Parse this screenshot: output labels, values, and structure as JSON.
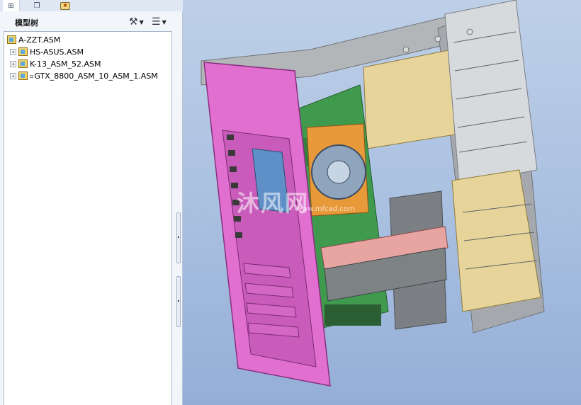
{
  "tabs": [
    {
      "icon": "model-tree-icon"
    },
    {
      "icon": "folder-browser-icon"
    },
    {
      "icon": "favorites-icon"
    }
  ],
  "model_tree": {
    "title": "模型树",
    "settings_icon": "settings-icon",
    "show_icon": "show-icon",
    "root": "A-ZZT.ASM",
    "items": [
      {
        "label": "HS-ASUS.ASM"
      },
      {
        "label": "K-13_ASM_52.ASM"
      },
      {
        "label": "GTX_8800_ASM_10_ASM_1.ASM"
      }
    ]
  },
  "viewport": {
    "watermark": "沐风网",
    "watermark_sub": "www.mfcad.com"
  },
  "colors": {
    "viewport_top": "#bed0e8",
    "viewport_bottom": "#94aed6",
    "case_frame_pink": "#e06fcf",
    "case_body_gray": "#a5a9ad",
    "drive_bay_tan": "#e7d49a",
    "motherboard_green": "#3f9a4e",
    "gpu_pink": "#e8a4a0",
    "cpu_cooler_orange": "#e89a3b"
  }
}
